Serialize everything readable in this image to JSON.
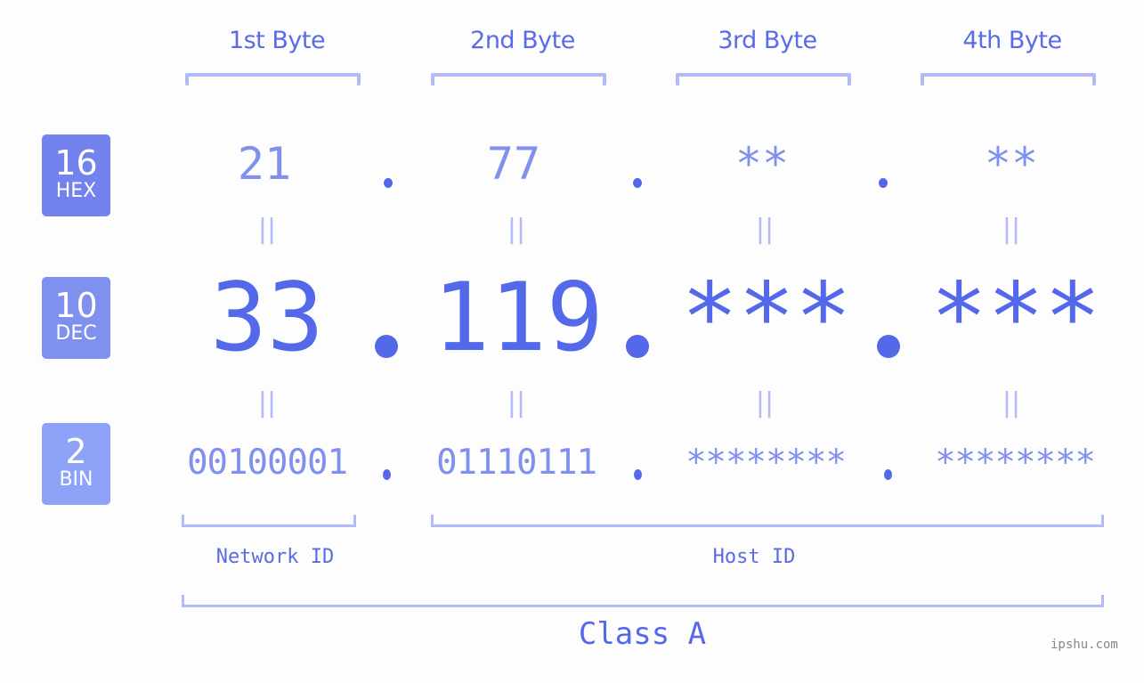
{
  "bytes": [
    {
      "label": "1st Byte",
      "hex": "21",
      "dec": "33",
      "bin": "00100001"
    },
    {
      "label": "2nd Byte",
      "hex": "77",
      "dec": "119",
      "bin": "01110111"
    },
    {
      "label": "3rd Byte",
      "hex": "**",
      "dec": "***",
      "bin": "********"
    },
    {
      "label": "4th Byte",
      "hex": "**",
      "dec": "***",
      "bin": "********"
    }
  ],
  "badges": {
    "hex": {
      "num": "16",
      "unit": "HEX",
      "color": "#7382ec"
    },
    "dec": {
      "num": "10",
      "unit": "DEC",
      "color": "#8090ef"
    },
    "bin": {
      "num": "2",
      "unit": "BIN",
      "color": "#8ea3f7"
    }
  },
  "equals_glyph": "||",
  "network_label": "Network ID",
  "host_label": "Host ID",
  "class_label": "Class A",
  "watermark": "ipshu.com",
  "colors": {
    "primary": "#5468ea",
    "light": "#8090ee",
    "bracket": "#b2baf8"
  }
}
